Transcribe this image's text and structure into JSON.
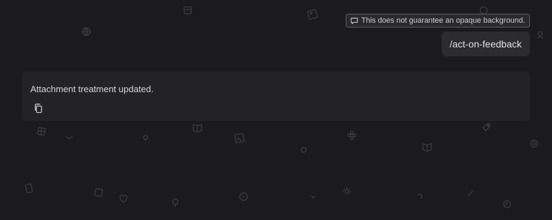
{
  "background": {
    "color": "#1b1b1d",
    "pattern_icon_color": "#3d3d40"
  },
  "feedback_note": {
    "icon": "comment-icon",
    "text": "This does not guarantee an opaque background."
  },
  "user_message": {
    "text": "/act-on-feedback"
  },
  "assistant_message": {
    "text": "Attachment treatment updated.",
    "actions": [
      {
        "icon": "copy-icon"
      }
    ]
  }
}
